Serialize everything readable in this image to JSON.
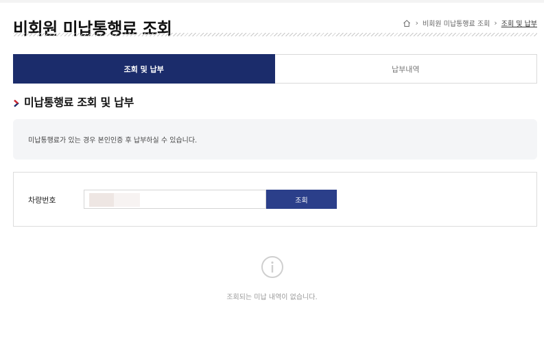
{
  "header": {
    "title": "비회원 미납통행료 조회",
    "breadcrumb": [
      {
        "label": "비회원 미납통행료 조회"
      },
      {
        "label": "조회 및 납부"
      }
    ]
  },
  "tabs": [
    {
      "label": "조회 및 납부",
      "active": true
    },
    {
      "label": "납부내역",
      "active": false
    }
  ],
  "section": {
    "title": "미납통행료 조회 및 납부"
  },
  "notice": {
    "text": "미납통행료가 있는 경우 본인인증 후 납부하실 수 있습니다."
  },
  "search": {
    "label": "차량번호",
    "input_value": "",
    "button_label": "조회"
  },
  "empty_state": {
    "icon": "info-icon",
    "message": "조회되는 미납 내역이 없습니다."
  },
  "colors": {
    "tab_active_bg": "#1b2c6b",
    "button_bg": "#2b3f8a",
    "chevron_accent": "#d4242b",
    "notice_bg": "#f4f5f7"
  }
}
